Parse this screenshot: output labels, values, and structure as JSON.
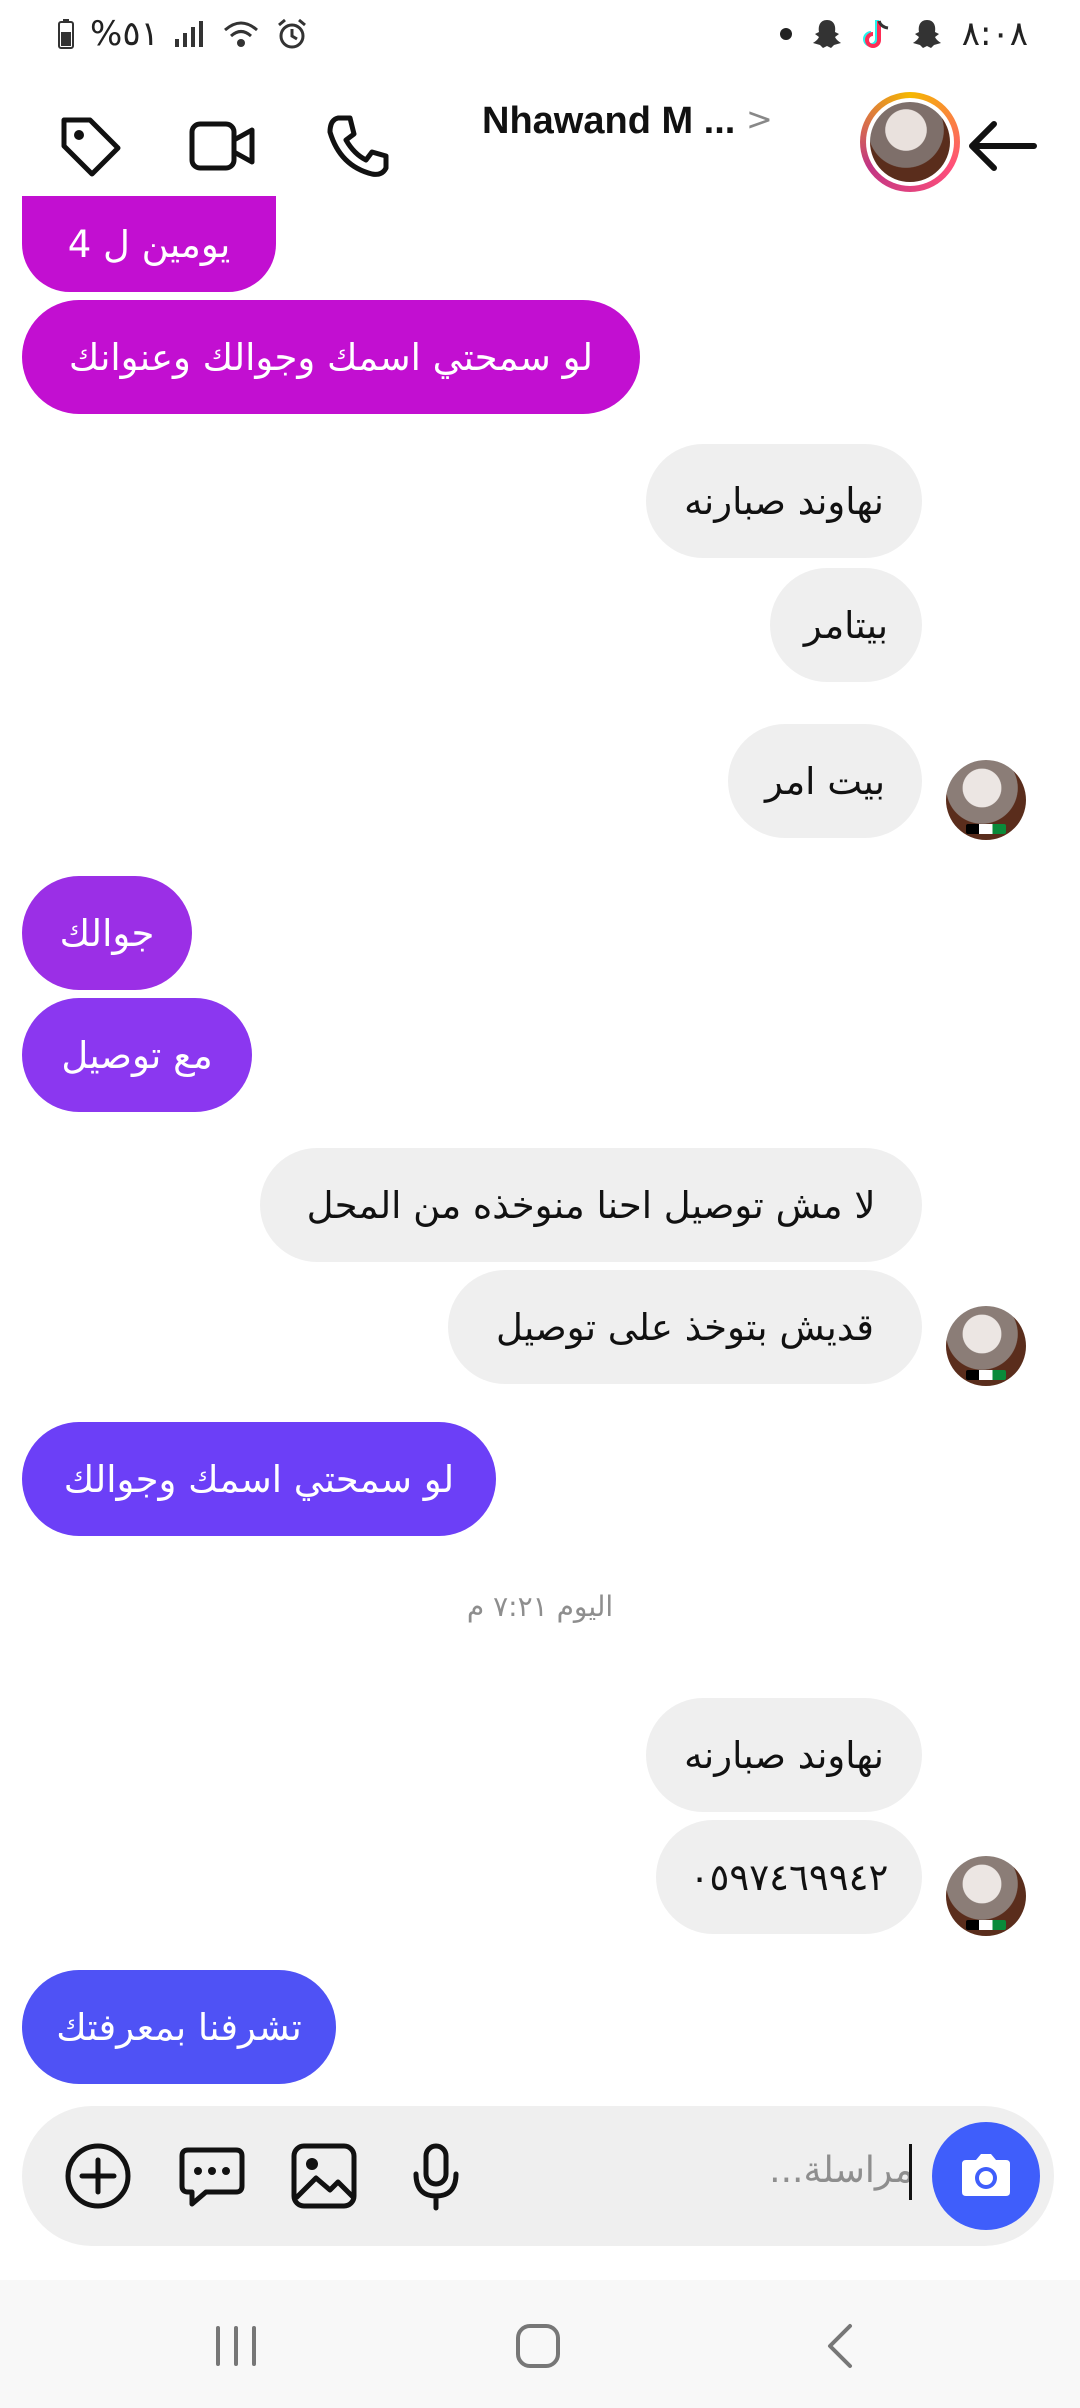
{
  "status_bar": {
    "battery": "%٥١",
    "time": "٨:٠٨"
  },
  "header": {
    "title": "Nhawand M ...",
    "chevron": ">"
  },
  "messages": [
    {
      "text": "يومين ل 4",
      "from": "me",
      "color": "#c20fd1"
    },
    {
      "text": "لو سمحتي اسمك وجوالك وعنوانك",
      "from": "me",
      "color": "#c20fd1"
    },
    {
      "text": "نهاوند صبارنه",
      "from": "them"
    },
    {
      "text": "بيتامر",
      "from": "them"
    },
    {
      "text": "بيت  امر",
      "from": "them"
    },
    {
      "text": "جوالك",
      "from": "me",
      "color": "#9b2fe6"
    },
    {
      "text": "مع توصيل",
      "from": "me",
      "color": "#8b37f0"
    },
    {
      "text": "لا مش توصيل احنا منوخذه من المحل",
      "from": "them"
    },
    {
      "text": "قديش بتوخذ على توصيل",
      "from": "them"
    },
    {
      "text": "لو سمحتي اسمك وجوالك",
      "from": "me",
      "color": "#6c3ff7"
    },
    {
      "text": "نهاوند صبارنه",
      "from": "them"
    },
    {
      "text": "٠٥٩٧٤٦٩٩٤٢",
      "from": "them"
    },
    {
      "text": "تشرفنا بمعرفتك",
      "from": "me",
      "color": "#4f52f5"
    }
  ],
  "timestamp": "اليوم ٧:٢١ م",
  "composer": {
    "placeholder": "...مراسلة"
  }
}
